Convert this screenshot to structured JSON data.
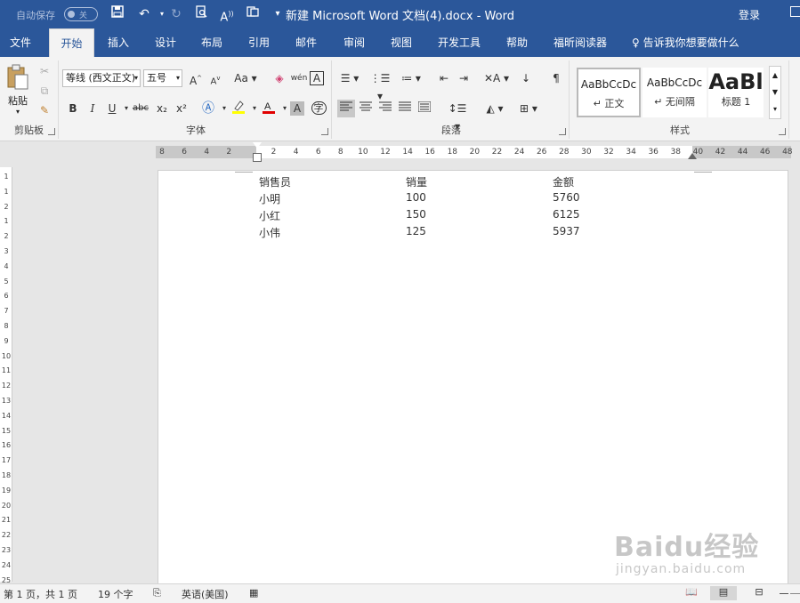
{
  "titlebar": {
    "autosave": "自动保存",
    "autosave_state": "关",
    "doc_title": "新建 Microsoft Word 文档(4).docx  -  Word",
    "login": "登录",
    "quick_access": [
      "save-icon",
      "undo-icon",
      "redo-icon",
      "print-preview-icon",
      "read-aloud-icon",
      "touch-mode-icon",
      "customize-icon"
    ]
  },
  "tabs": [
    "文件",
    "开始",
    "插入",
    "设计",
    "布局",
    "引用",
    "邮件",
    "审阅",
    "视图",
    "开发工具",
    "帮助",
    "福昕阅读器"
  ],
  "active_tab": "开始",
  "tellme": "告诉我你想要做什么",
  "ribbon": {
    "clipboard": {
      "label": "剪贴板",
      "paste": "粘贴"
    },
    "font": {
      "label": "字体",
      "font_name": "等线 (西文正文)",
      "font_size": "五号",
      "bold": "B",
      "italic": "I",
      "underline": "U",
      "strike": "abc",
      "sub": "x₂",
      "sup": "x²",
      "grow": "A",
      "shrink": "A",
      "case": "Aa",
      "phonetic": "wén",
      "border_char": "A",
      "enclose": "字"
    },
    "paragraph": {
      "label": "段落"
    },
    "styles": {
      "label": "样式",
      "items": [
        {
          "sample": "AaBbCcDc",
          "name": "↵ 正文"
        },
        {
          "sample": "AaBbCcDc",
          "name": "↵ 无间隔"
        },
        {
          "sample": "AaBl",
          "name": "标题 1"
        }
      ]
    }
  },
  "ruler_h": [
    "8",
    "6",
    "4",
    "2",
    "",
    "2",
    "4",
    "6",
    "8",
    "10",
    "12",
    "14",
    "16",
    "18",
    "20",
    "22",
    "24",
    "26",
    "28",
    "30",
    "32",
    "34",
    "36",
    "38",
    "40",
    "42",
    "44",
    "46",
    "48"
  ],
  "ruler_v": [
    "1",
    "1",
    "2",
    "1",
    "2",
    "3",
    "4",
    "5",
    "6",
    "7",
    "8",
    "9",
    "10",
    "11",
    "12",
    "13",
    "14",
    "15",
    "16",
    "17",
    "18",
    "19",
    "20",
    "21",
    "22",
    "23",
    "24",
    "25"
  ],
  "document": {
    "header": [
      "销售员",
      "销量",
      "金额"
    ],
    "rows": [
      [
        "小明",
        "100",
        "5760"
      ],
      [
        "小红",
        "150",
        "6125"
      ],
      [
        "小伟",
        "125",
        "5937"
      ]
    ]
  },
  "statusbar": {
    "pages": "第 1 页，共 1 页",
    "words": "19 个字",
    "language": "英语(美国)"
  },
  "watermark": {
    "line1": "Baidu经验",
    "line2": "jingyan.baidu.com"
  },
  "colors": {
    "brand": "#2b579a",
    "ribbon_bg": "#f3f3f3",
    "font_color_red": "#e00000",
    "highlight_yellow": "#ffff00"
  }
}
